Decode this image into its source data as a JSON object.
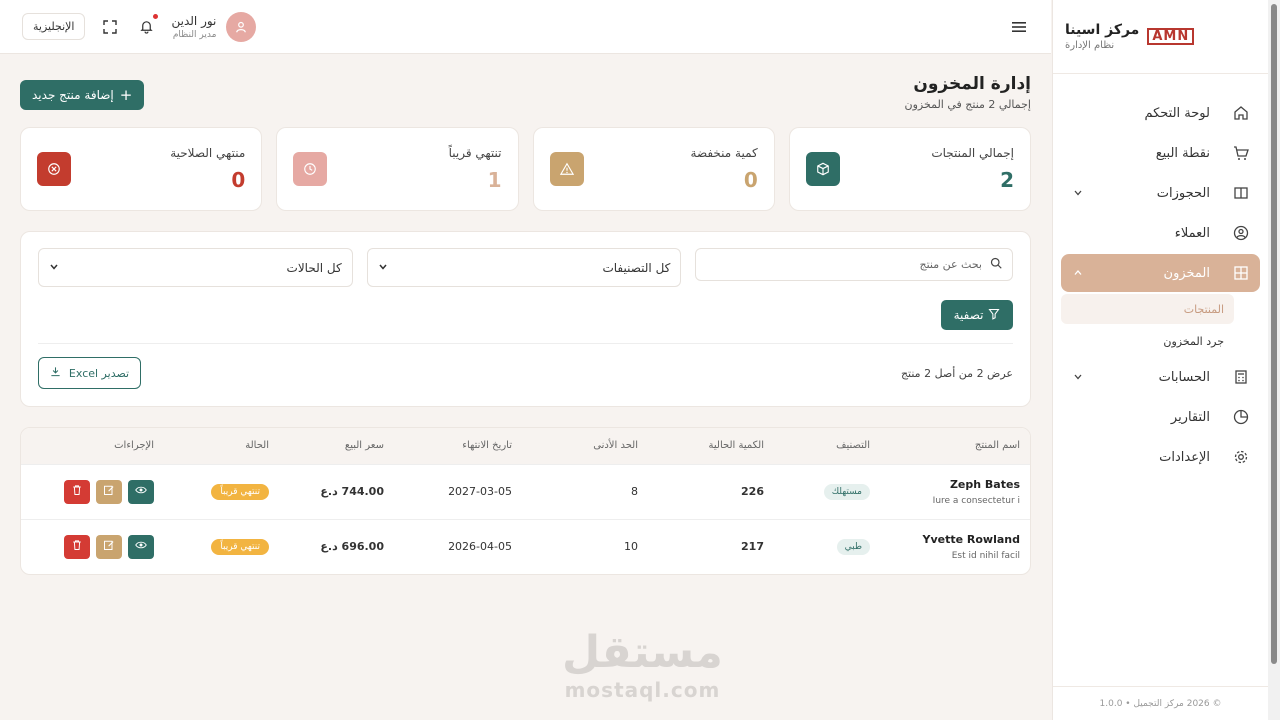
{
  "sidebar": {
    "brand_logo": "AMN",
    "brand_title": "مركز اسينا",
    "brand_subtitle": "نظام الإدارة",
    "nav": [
      {
        "label": "لوحة التحكم",
        "icon": "home-icon"
      },
      {
        "label": "نقطة البيع",
        "icon": "cart-icon"
      },
      {
        "label": "الحجوزات",
        "icon": "book-icon"
      },
      {
        "label": "العملاء",
        "icon": "user-circle-icon"
      },
      {
        "label": "المخزون",
        "icon": "warehouse-icon"
      },
      {
        "label": "الحسابات",
        "icon": "calculator-icon"
      },
      {
        "label": "التقارير",
        "icon": "pie-chart-icon"
      },
      {
        "label": "الإعدادات",
        "icon": "gear-icon"
      }
    ],
    "sub_items": [
      "المنتجات",
      "جرد المخزون"
    ],
    "footer": "© 2026 مركز التجميل • 1.0.0"
  },
  "topbar": {
    "language": "الإنجليزية",
    "user_name": "نور الدين",
    "user_role": "مدير النظام"
  },
  "page": {
    "title": "إدارة المخزون",
    "subtitle": "إجمالي 2 منتج في المخزون",
    "add_button": "إضافة منتج جديد"
  },
  "stats": [
    {
      "label": "إجمالي المنتجات",
      "value": "2",
      "color": "#2f6e66",
      "icon": "box-icon"
    },
    {
      "label": "كمية منخفضة",
      "value": "0",
      "color": "#c9a46f",
      "icon": "warning-icon"
    },
    {
      "label": "تنتهي قريباً",
      "value": "1",
      "color": "#e6a9a3",
      "icon": "clock-icon"
    },
    {
      "label": "منتهي الصلاحية",
      "value": "0",
      "color": "#c33c2e",
      "icon": "x-circle-icon"
    }
  ],
  "filters": {
    "search_placeholder": "بحث عن منتج",
    "category": "كل التصنيفات",
    "status": "كل الحالات",
    "filter_button": "تصفية",
    "count_text": "عرض 2 من أصل 2 منتج",
    "export_button": "تصدير Excel"
  },
  "table": {
    "headers": [
      "اسم المنتج",
      "التصنيف",
      "الكمية الحالية",
      "الحد الأدنى",
      "تاريخ الانتهاء",
      "سعر البيع",
      "الحالة",
      "الإجراءات"
    ],
    "rows": [
      {
        "name": "Zeph Bates",
        "desc": "Iure a consectetur i",
        "category": "مستهلك",
        "qty": "226",
        "min": "8",
        "expiry": "2027-03-05",
        "price": "744.00 د.ع",
        "status": "تنتهي قريباً"
      },
      {
        "name": "Yvette Rowland",
        "desc": "Est id nihil facil",
        "category": "طبي",
        "qty": "217",
        "min": "10",
        "expiry": "2026-04-05",
        "price": "696.00 د.ع",
        "status": "تنتهي قريباً"
      }
    ]
  },
  "watermark": {
    "line1": "مستقل",
    "line2": "mostaql.com"
  }
}
